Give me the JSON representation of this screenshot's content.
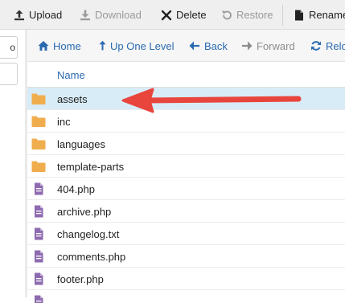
{
  "toolbar": {
    "upload": "Upload",
    "download": "Download",
    "delete": "Delete",
    "restore": "Restore",
    "rename": "Rename"
  },
  "left_pane": {
    "field_fragment": "o"
  },
  "nav": {
    "home": "Home",
    "up_one_level": "Up One Level",
    "back": "Back",
    "forward": "Forward",
    "reload": "Relo"
  },
  "list": {
    "column_name": "Name",
    "items": [
      {
        "name": "assets",
        "type": "folder",
        "selected": true
      },
      {
        "name": "inc",
        "type": "folder"
      },
      {
        "name": "languages",
        "type": "folder"
      },
      {
        "name": "template-parts",
        "type": "folder"
      },
      {
        "name": "404.php",
        "type": "file"
      },
      {
        "name": "archive.php",
        "type": "file"
      },
      {
        "name": "changelog.txt",
        "type": "file"
      },
      {
        "name": "comments.php",
        "type": "file"
      },
      {
        "name": "footer.php",
        "type": "file"
      }
    ]
  },
  "colors": {
    "folder": "#f0ad4e",
    "file": "#8e6bb0",
    "link": "#2a6ab0",
    "selected_row": "#d8ecf7",
    "arrow": "#e8453c"
  }
}
